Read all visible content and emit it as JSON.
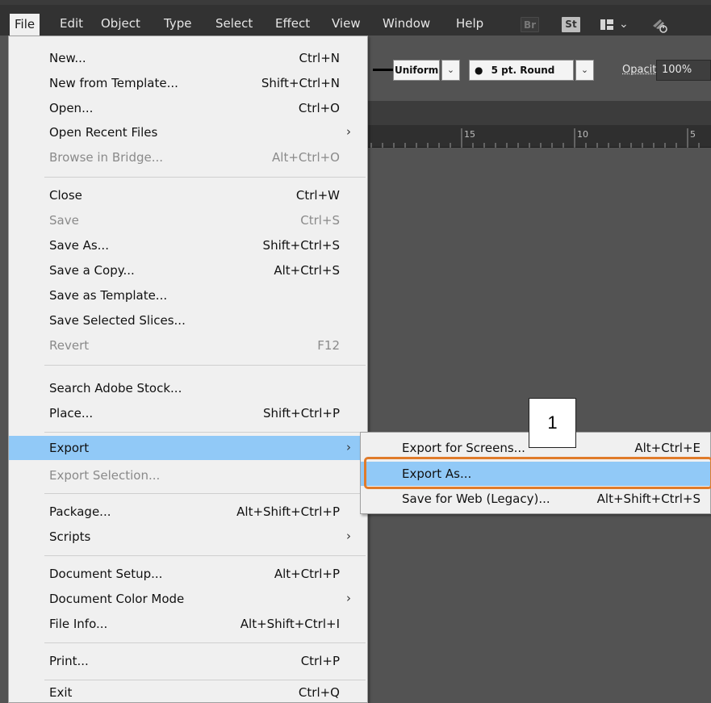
{
  "menubar": {
    "items": [
      "File",
      "Edit",
      "Object",
      "Type",
      "Select",
      "Effect",
      "View",
      "Window",
      "Help"
    ],
    "bridge_badge": "Br",
    "stock_badge": "St"
  },
  "controlbar": {
    "stroke_profile": "Uniform",
    "brush": "5 pt. Round",
    "opacity_label": "Opacity:",
    "opacity_value": "100%"
  },
  "ruler": {
    "labels": [
      "15",
      "10",
      "5"
    ]
  },
  "file_menu": {
    "items": [
      {
        "label": "New...",
        "shortcut": "Ctrl+N"
      },
      {
        "label": "New from Template...",
        "shortcut": "Shift+Ctrl+N"
      },
      {
        "label": "Open...",
        "shortcut": "Ctrl+O"
      },
      {
        "label": "Open Recent Files",
        "shortcut": ""
      },
      {
        "label": "Browse in Bridge...",
        "shortcut": "Alt+Ctrl+O"
      },
      {
        "label": "Close",
        "shortcut": "Ctrl+W"
      },
      {
        "label": "Save",
        "shortcut": "Ctrl+S"
      },
      {
        "label": "Save As...",
        "shortcut": "Shift+Ctrl+S"
      },
      {
        "label": "Save a Copy...",
        "shortcut": "Alt+Ctrl+S"
      },
      {
        "label": "Save as Template...",
        "shortcut": ""
      },
      {
        "label": "Save Selected Slices...",
        "shortcut": ""
      },
      {
        "label": "Revert",
        "shortcut": "F12"
      },
      {
        "label": "Search Adobe Stock...",
        "shortcut": ""
      },
      {
        "label": "Place...",
        "shortcut": "Shift+Ctrl+P"
      },
      {
        "label": "Export",
        "shortcut": ""
      },
      {
        "label": "Export Selection...",
        "shortcut": ""
      },
      {
        "label": "Package...",
        "shortcut": "Alt+Shift+Ctrl+P"
      },
      {
        "label": "Scripts",
        "shortcut": ""
      },
      {
        "label": "Document Setup...",
        "shortcut": "Alt+Ctrl+P"
      },
      {
        "label": "Document Color Mode",
        "shortcut": ""
      },
      {
        "label": "File Info...",
        "shortcut": "Alt+Shift+Ctrl+I"
      },
      {
        "label": "Print...",
        "shortcut": "Ctrl+P"
      },
      {
        "label": "Exit",
        "shortcut": "Ctrl+Q"
      }
    ]
  },
  "export_submenu": {
    "items": [
      {
        "label": "Export for Screens...",
        "shortcut": "Alt+Ctrl+E"
      },
      {
        "label": "Export As...",
        "shortcut": ""
      },
      {
        "label": "Save for Web (Legacy)...",
        "shortcut": "Alt+Shift+Ctrl+S"
      }
    ]
  },
  "callout": {
    "number": "1"
  },
  "colors": {
    "highlight": "#91c9f7",
    "annotation_border": "#e07b2a",
    "menubar_bg": "#323232",
    "workspace_bg": "#535353"
  }
}
